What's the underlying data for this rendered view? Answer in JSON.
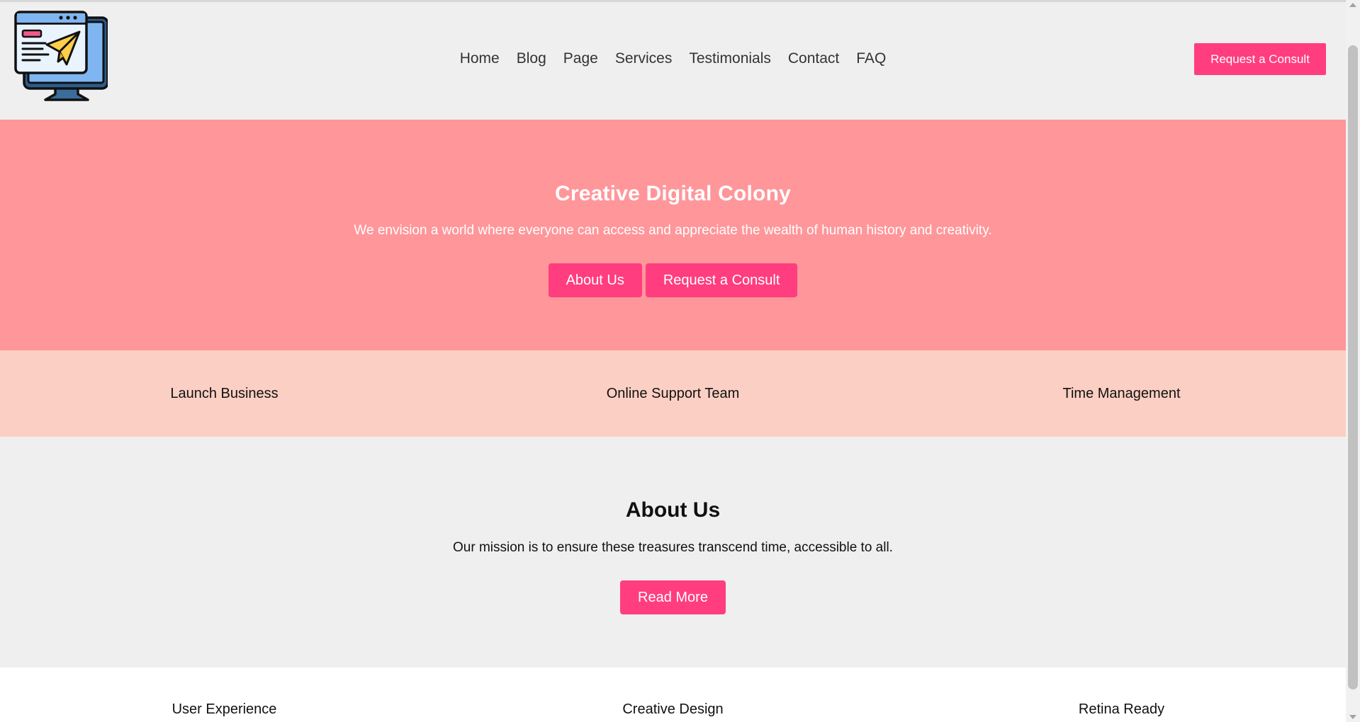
{
  "header": {
    "logo_icon": "computer-paper-plane-icon",
    "nav": [
      "Home",
      "Blog",
      "Page",
      "Services",
      "Testimonials",
      "Contact",
      "FAQ"
    ],
    "cta_label": "Request a Consult"
  },
  "hero": {
    "title": "Creative Digital Colony",
    "subtitle": "We envision a world where everyone can access and appreciate the wealth of human history and creativity.",
    "buttons": [
      "About Us",
      "Request a Consult"
    ]
  },
  "features": [
    "Launch Business",
    "Online Support Team",
    "Time Management"
  ],
  "about": {
    "title": "About Us",
    "text": "Our mission is to ensure these treasures transcend time, accessible to all.",
    "button_label": "Read More"
  },
  "features2": [
    "User Experience",
    "Creative Design",
    "Retina Ready"
  ],
  "colors": {
    "accent": "#ff3d7f",
    "hero_bg": "#ff969a",
    "features_bg": "#fbcfc3",
    "page_bg": "#efefef"
  }
}
